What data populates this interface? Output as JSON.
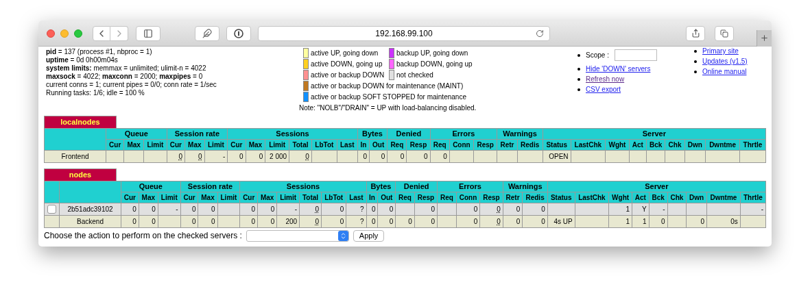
{
  "browser": {
    "address": "192.168.99.100"
  },
  "stats": [
    "**pid** = 137 (process #1, nbproc = 1)",
    "**uptime** = 0d 0h00m04s",
    "**system limits:** memmax = unlimited; ulimit-n = 4022",
    "**maxsock** = 4022; **maxconn** = 2000; **maxpipes** = 0",
    "current conns = 1; current pipes = 0/0; conn rate = 1/sec",
    "Running tasks: 1/6; idle = 100 %"
  ],
  "legend": {
    "rows": [
      [
        {
          "color": "#ffffa0",
          "label": "active UP, going down"
        },
        {
          "color": "#cc33ff",
          "label": "backup UP, going down"
        }
      ],
      [
        {
          "color": "#ffd020",
          "label": "active DOWN, going up"
        },
        {
          "color": "#ff66ff",
          "label": "backup DOWN, going up"
        }
      ],
      [
        {
          "color": "#ff9090",
          "label": "active or backup DOWN"
        },
        {
          "color": "#e0e0e0",
          "label": "not checked"
        }
      ],
      [
        {
          "color": "#c07820",
          "label": "active or backup DOWN for maintenance (MAINT)"
        }
      ],
      [
        {
          "color": "#1090ff",
          "label": "active or backup SOFT STOPPED for maintenance"
        }
      ]
    ],
    "note": "Note: \"NOLB\"/\"DRAIN\" = UP with load-balancing disabled."
  },
  "scope": {
    "label": "Scope :"
  },
  "actions": [
    {
      "label": "Hide 'DOWN' servers",
      "visited": false
    },
    {
      "label": "Refresh now",
      "visited": true
    },
    {
      "label": "CSV export",
      "visited": false
    }
  ],
  "links": [
    {
      "label": "Primary site",
      "visited": false
    },
    {
      "label": "Updates (v1.5)",
      "visited": false
    },
    {
      "label": "Online manual",
      "visited": false
    }
  ],
  "tables": [
    {
      "title": "localnodes",
      "has_checkbox": false,
      "groups": [
        {
          "label": "Queue",
          "columns": [
            "Cur",
            "Max",
            "Limit"
          ]
        },
        {
          "label": "Session rate",
          "columns": [
            "Cur",
            "Max",
            "Limit"
          ]
        },
        {
          "label": "Sessions",
          "columns": [
            "Cur",
            "Max",
            "Limit",
            "Total",
            "LbTot",
            "Last"
          ]
        },
        {
          "label": "Bytes",
          "columns": [
            "In",
            "Out"
          ]
        },
        {
          "label": "Denied",
          "columns": [
            "Req",
            "Resp"
          ]
        },
        {
          "label": "Errors",
          "columns": [
            "Req",
            "Conn",
            "Resp"
          ]
        },
        {
          "label": "Warnings",
          "columns": [
            "Retr",
            "Redis"
          ]
        },
        {
          "label": "Server",
          "columns": [
            "Status",
            "LastChk",
            "Wght",
            "Act",
            "Bck",
            "Chk",
            "Dwn",
            "Dwntme",
            "Thrtle"
          ]
        }
      ],
      "rows": [
        {
          "kind": "frontend",
          "cells": [
            {
              "text": "Frontend"
            },
            {},
            {},
            {},
            {
              "text": "0",
              "dotted": true
            },
            {
              "text": "0",
              "dotted": true
            },
            {
              "text": "-"
            },
            {
              "text": "0"
            },
            {
              "text": "0"
            },
            {
              "text": "2 000"
            },
            {
              "text": "0",
              "dotted": true
            },
            {},
            {},
            {
              "text": "0"
            },
            {
              "text": "0"
            },
            {
              "text": "0"
            },
            {
              "text": "0"
            },
            {
              "text": "0"
            },
            {},
            {},
            {},
            {},
            {
              "text": "OPEN"
            },
            {},
            {},
            {},
            {},
            {},
            {},
            {},
            {}
          ]
        }
      ]
    },
    {
      "title": "nodes",
      "has_checkbox": true,
      "groups": [
        {
          "label": "Queue",
          "columns": [
            "Cur",
            "Max",
            "Limit"
          ]
        },
        {
          "label": "Session rate",
          "columns": [
            "Cur",
            "Max",
            "Limit"
          ]
        },
        {
          "label": "Sessions",
          "columns": [
            "Cur",
            "Max",
            "Limit",
            "Total",
            "LbTot",
            "Last"
          ]
        },
        {
          "label": "Bytes",
          "columns": [
            "In",
            "Out"
          ]
        },
        {
          "label": "Denied",
          "columns": [
            "Req",
            "Resp"
          ]
        },
        {
          "label": "Errors",
          "columns": [
            "Req",
            "Conn",
            "Resp"
          ]
        },
        {
          "label": "Warnings",
          "columns": [
            "Retr",
            "Redis"
          ]
        },
        {
          "label": "Server",
          "columns": [
            "Status",
            "LastChk",
            "Wght",
            "Act",
            "Bck",
            "Chk",
            "Dwn",
            "Dwntme",
            "Thrtle"
          ]
        }
      ],
      "rows": [
        {
          "kind": "server",
          "checked": false,
          "cells": [
            {
              "text": "2b51adc39102"
            },
            {
              "text": "0"
            },
            {
              "text": "0"
            },
            {
              "text": "-"
            },
            {
              "text": "0"
            },
            {
              "text": "0"
            },
            {},
            {
              "text": "0"
            },
            {
              "text": "0"
            },
            {
              "text": "-"
            },
            {
              "text": "0",
              "dotted": true
            },
            {
              "text": "0"
            },
            {
              "text": "?"
            },
            {
              "text": "0"
            },
            {
              "text": "0"
            },
            {},
            {
              "text": "0"
            },
            {},
            {
              "text": "0"
            },
            {
              "text": "0",
              "dotted": true
            },
            {
              "text": "0"
            },
            {
              "text": "0"
            },
            {},
            {},
            {
              "text": "1"
            },
            {
              "text": "Y"
            },
            {
              "text": "-"
            },
            {},
            {},
            {},
            {
              "text": "-"
            }
          ]
        },
        {
          "kind": "backend",
          "cells": [
            {
              "text": "Backend"
            },
            {
              "text": "0"
            },
            {
              "text": "0"
            },
            {},
            {
              "text": "0"
            },
            {
              "text": "0"
            },
            {},
            {
              "text": "0"
            },
            {
              "text": "0"
            },
            {
              "text": "200"
            },
            {
              "text": "0",
              "dotted": true
            },
            {
              "text": "0"
            },
            {
              "text": "?"
            },
            {
              "text": "0"
            },
            {
              "text": "0"
            },
            {
              "text": "0"
            },
            {
              "text": "0"
            },
            {},
            {
              "text": "0"
            },
            {
              "text": "0",
              "dotted": true
            },
            {
              "text": "0"
            },
            {
              "text": "0"
            },
            {
              "text": "4s UP"
            },
            {},
            {
              "text": "1"
            },
            {
              "text": "1"
            },
            {
              "text": "0"
            },
            {},
            {
              "text": "0"
            },
            {
              "text": "0s"
            },
            {}
          ]
        }
      ]
    }
  ],
  "action_form": {
    "label": "Choose the action to perform on the checked servers :",
    "button": "Apply"
  }
}
